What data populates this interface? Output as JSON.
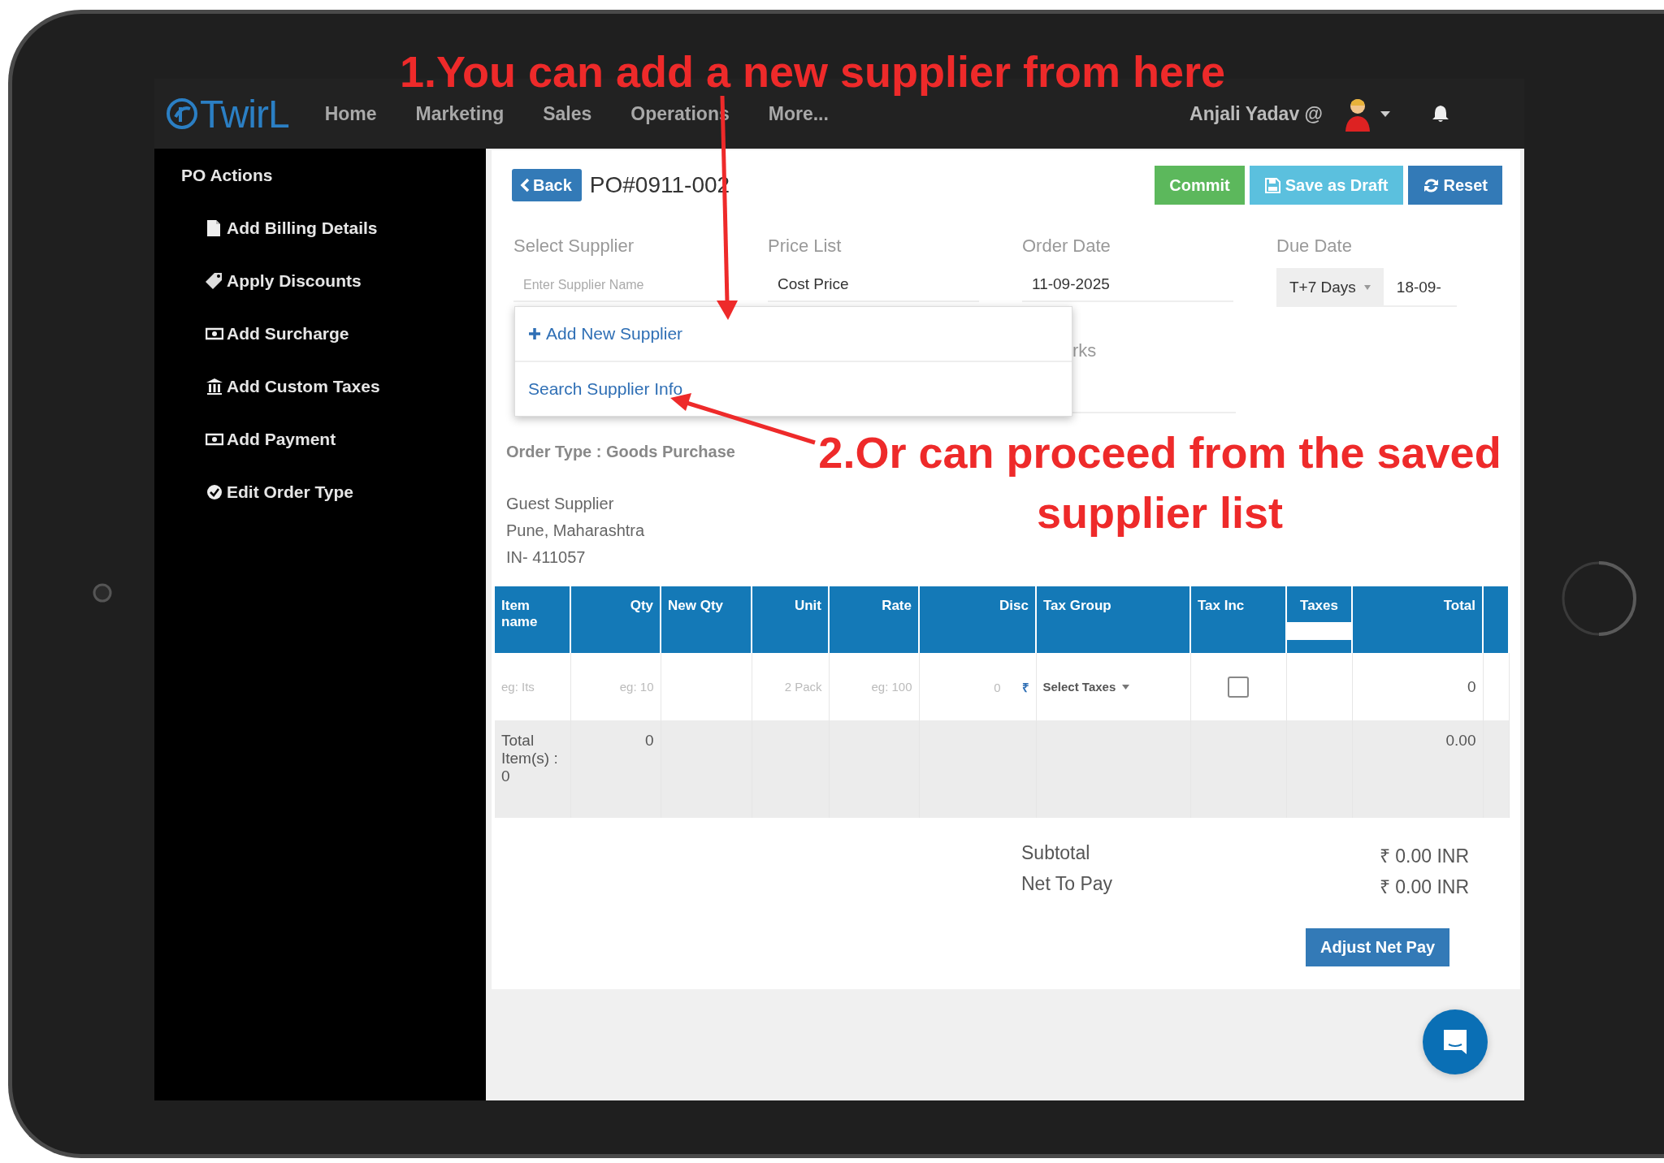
{
  "annotations": [
    {
      "text": "1.You can add a new supplier from here"
    },
    {
      "text": "2.Or can proceed from the saved supplier list"
    }
  ],
  "nav": {
    "logo": "TwirL",
    "items": [
      "Home",
      "Marketing",
      "Sales",
      "Operations",
      "More..."
    ],
    "user": "Anjali Yadav @"
  },
  "sidebar": {
    "title": "PO Actions",
    "items": [
      "Add Billing Details",
      "Apply Discounts",
      "Add Surcharge",
      "Add Custom Taxes",
      "Add Payment",
      "Edit Order Type"
    ]
  },
  "header": {
    "back": "Back",
    "po_number": "PO#0911-002",
    "buttons": [
      {
        "label": "Commit",
        "kind": "commit"
      },
      {
        "label": "Save as Draft",
        "kind": "draft"
      },
      {
        "label": "Reset",
        "kind": "reset"
      }
    ]
  },
  "fields": [
    {
      "label": "Select Supplier",
      "placeholder": "Enter Supplier Name"
    },
    {
      "label": "Price List",
      "value": "Cost Price"
    },
    {
      "label": "Order Date",
      "value": "11-09-2025"
    },
    {
      "label": "Due Date",
      "select": "T+7 Days",
      "value": "18-09-"
    }
  ],
  "supplier_menu": [
    "Add New Supplier",
    "Search Supplier Info"
  ],
  "remarks_label": "rks",
  "order_type": "Order Type : Goods Purchase",
  "supplier_address": [
    "Guest Supplier",
    "Pune, Maharashtra",
    "IN- 411057"
  ],
  "table": {
    "columns": [
      "Item name",
      "Qty",
      "New Qty",
      "Unit",
      "Rate",
      "Disc",
      "Tax Group",
      "Tax Inc",
      "Taxes",
      "Total"
    ],
    "rows": [
      {
        "cells": [
          {
            "kind": "placeholder",
            "text": "eg: Its"
          },
          {
            "kind": "placeholder",
            "text": "eg: 10"
          },
          {
            "kind": "empty"
          },
          {
            "kind": "placeholder",
            "text": "2 Pack"
          },
          {
            "kind": "placeholder",
            "text": "eg: 100"
          },
          {
            "kind": "disc",
            "text": "0",
            "symbol": "₹"
          },
          {
            "kind": "select",
            "text": "Select Taxes"
          },
          {
            "kind": "checkbox",
            "checked": false
          },
          {
            "kind": "empty"
          },
          {
            "kind": "value",
            "text": "0"
          }
        ]
      },
      {
        "cells": [
          {
            "kind": "value",
            "text": "Total Item(s) : 0"
          },
          {
            "kind": "value",
            "text": "0"
          },
          {
            "kind": "empty"
          },
          {
            "kind": "empty"
          },
          {
            "kind": "empty"
          },
          {
            "kind": "empty"
          },
          {
            "kind": "empty"
          },
          {
            "kind": "empty"
          },
          {
            "kind": "empty"
          },
          {
            "kind": "value",
            "text": "0.00"
          }
        ]
      }
    ]
  },
  "summary": [
    {
      "label": "Subtotal",
      "value": "₹ 0.00 INR"
    },
    {
      "label": "Net To Pay",
      "value": "₹ 0.00 INR"
    }
  ],
  "adjust_button": "Adjust Net Pay"
}
